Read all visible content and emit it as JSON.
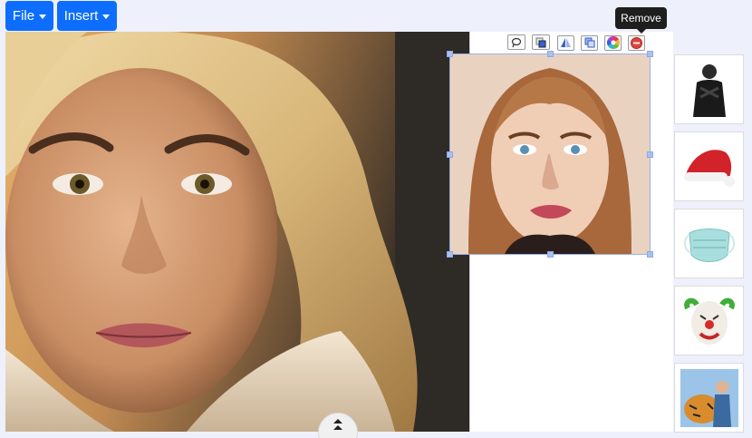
{
  "menu": {
    "file_label": "File",
    "insert_label": "Insert"
  },
  "tooltip": {
    "remove": "Remove"
  },
  "object_toolbar": {
    "buttons": [
      "lasso-icon",
      "layer-icon",
      "flip-icon",
      "duplicate-icon",
      "color-wheel-icon",
      "remove-icon"
    ]
  },
  "sidebar": {
    "items": [
      {
        "name": "thumbnail-person-dark-coat"
      },
      {
        "name": "thumbnail-santa-hat"
      },
      {
        "name": "thumbnail-face-mask"
      },
      {
        "name": "thumbnail-clown-mask"
      },
      {
        "name": "thumbnail-tiger-photo"
      }
    ]
  },
  "colors": {
    "primary": "#0d6efd",
    "background": "#eef0fc",
    "tooltip_bg": "#1e1e1e"
  }
}
